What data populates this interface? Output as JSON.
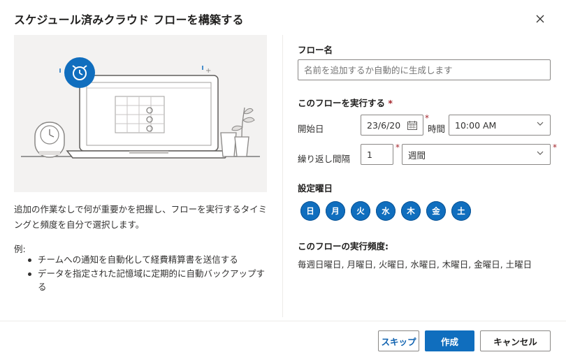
{
  "dialog": {
    "title": "スケジュール済みクラウド フローを構築する",
    "close_icon": "close-icon"
  },
  "left": {
    "description": "追加の作業なしで何が重要かを把握し、フローを実行するタイミングと頻度を自分で選択します。",
    "example_label": "例:",
    "examples": [
      "チームへの通知を自動化して経費精算書を送信する",
      "データを指定された記憶域に定期的に自動バックアップする"
    ]
  },
  "form": {
    "flow_name_label": "フロー名",
    "flow_name_placeholder": "名前を追加するか自動的に生成します",
    "run_section_label": "このフローを実行する",
    "required_mark": "*",
    "start_date_label": "開始日",
    "start_date_value": "23/6/20",
    "time_label": "時間",
    "time_value": "10:00 AM",
    "repeat_label": "繰り返し間隔",
    "repeat_count": "1",
    "repeat_unit": "週間",
    "weekday_label": "設定曜日",
    "weekdays": [
      "日",
      "月",
      "火",
      "水",
      "木",
      "金",
      "土"
    ],
    "frequency_label": "このフローの実行頻度:",
    "frequency_value": "毎週日曜日, 月曜日, 火曜日, 水曜日, 木曜日, 金曜日, 土曜日"
  },
  "footer": {
    "skip": "スキップ",
    "create": "作成",
    "cancel": "キャンセル"
  },
  "colors": {
    "accent": "#106ebe",
    "required": "#a4262c",
    "illustration_bg": "#f3f2f1"
  }
}
